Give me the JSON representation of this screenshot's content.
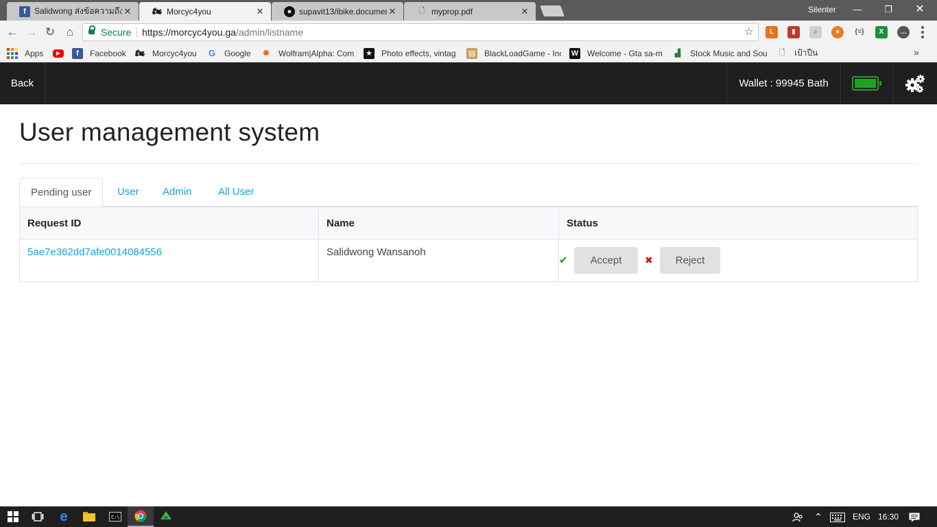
{
  "browser": {
    "tabs": [
      {
        "title": "Salidwong ส่งข้อความถึง Sr",
        "icon": "facebook-icon",
        "active": false
      },
      {
        "title": "Morcyc4you",
        "icon": "motorcycle-icon",
        "active": true
      },
      {
        "title": "supavit13/ibike.documen",
        "icon": "github-icon",
        "active": false
      },
      {
        "title": "myprop.pdf",
        "icon": "document-icon",
        "active": false
      }
    ],
    "window_user": "Silenter",
    "secure_label": "Secure",
    "url_host": "https://morcyc4you.ga",
    "url_path": "/admin/listname",
    "bookmarks": [
      "Apps",
      "",
      "Facebook",
      "Morcyc4you",
      "Google",
      "Wolfram|Alpha: Com",
      "Photo effects, vintag",
      "BlackLoadGame - Inc",
      "Welcome - Gta sa-m",
      "Stock Music and Sou",
      "เป้าปืน"
    ]
  },
  "navbar": {
    "back_label": "Back",
    "wallet_label": "Wallet : 99945 Bath",
    "battery_level": 1.0,
    "colors": {
      "bg": "#1f1f21",
      "battery": "#1fa21f"
    }
  },
  "page": {
    "title": "User management system",
    "tabs": [
      {
        "label": "Pending user",
        "active": true
      },
      {
        "label": "User",
        "active": false
      },
      {
        "label": "Admin",
        "active": false
      },
      {
        "label": "All User",
        "active": false
      }
    ],
    "table": {
      "headers": [
        "Request ID",
        "Name",
        "Status"
      ],
      "rows": [
        {
          "request_id": "5ae7e362dd7afe0014084556",
          "name": "Salidwong Wansanoh",
          "accept_label": "Accept",
          "reject_label": "Reject"
        }
      ]
    },
    "colors": {
      "link": "#17a2d8",
      "accept_icon": "#119e11",
      "reject_icon": "#e01010"
    }
  },
  "taskbar": {
    "language": "ENG",
    "time": "16:30"
  }
}
